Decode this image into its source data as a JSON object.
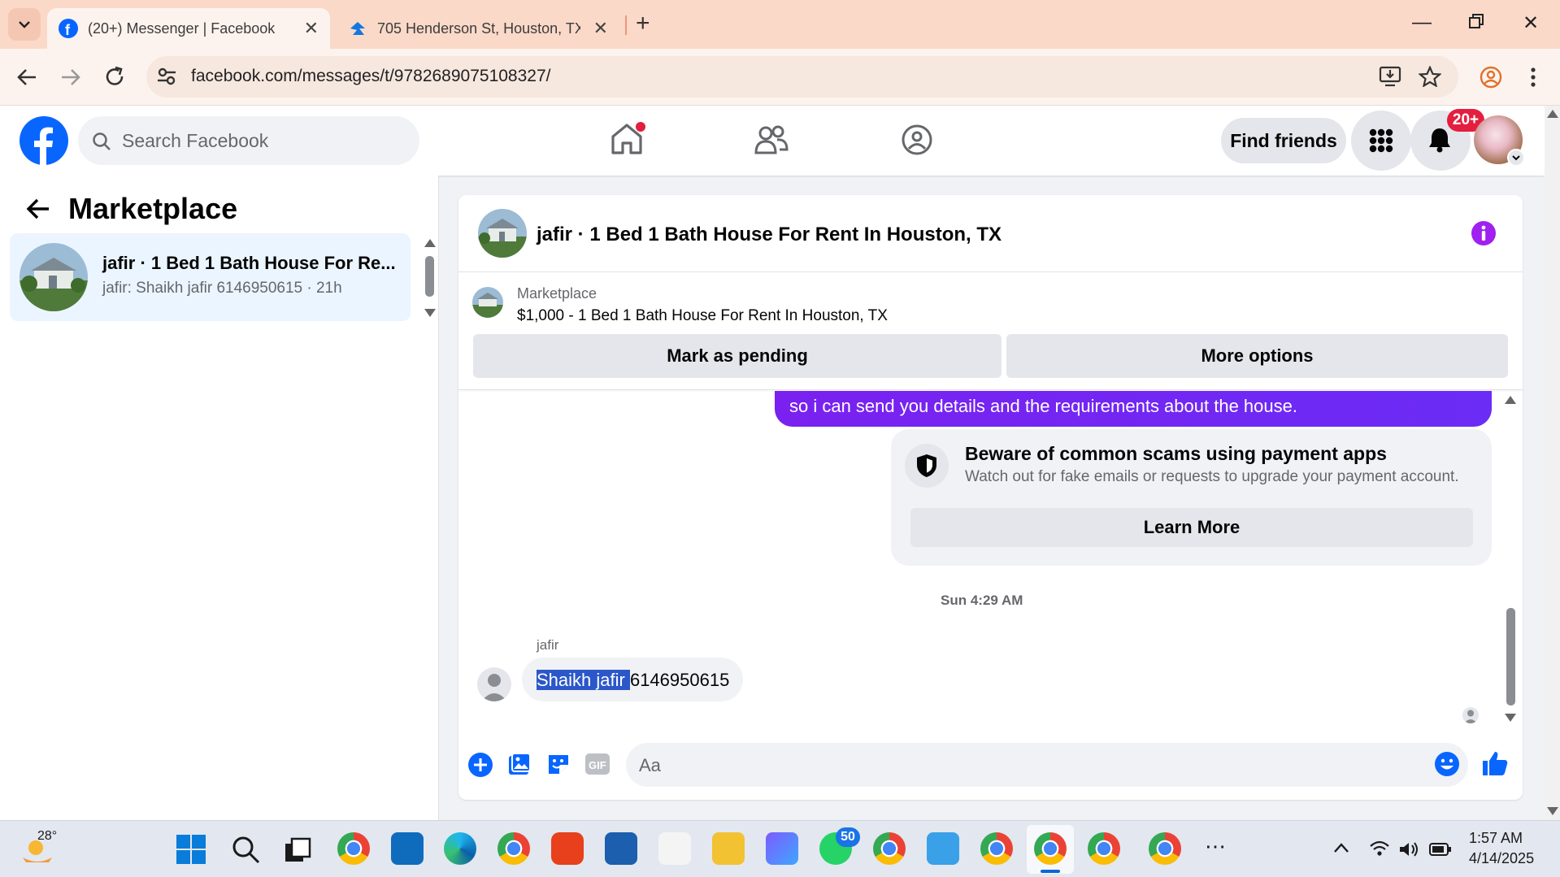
{
  "browser": {
    "tabs": [
      {
        "title": "(20+) Messenger | Facebook",
        "icon": "facebook-icon"
      },
      {
        "title": "705 Henderson St, Houston, TX",
        "icon": "zillow-icon"
      }
    ],
    "url": "facebook.com/messages/t/9782689075108327/"
  },
  "fb_header": {
    "search_placeholder": "Search Facebook",
    "find_friends": "Find friends",
    "notification_badge": "20+"
  },
  "left_panel": {
    "title": "Marketplace",
    "conversations": [
      {
        "name": "jafir · 1 Bed 1 Bath House For Re...",
        "preview": "jafir: Shaikh jafir 6146950615 · 21h"
      }
    ]
  },
  "chat": {
    "title": "jafir · 1 Bed 1 Bath House For Rent In Houston, TX",
    "marketplace_label": "Marketplace",
    "listing": "$1,000 - 1 Bed 1 Bath House For Rent In Houston, TX",
    "mark_pending": "Mark as pending",
    "more_options": "More options",
    "outgoing_message": "so i can send you details and the requirements about the house.",
    "scam_title": "Beware of common scams using payment apps",
    "scam_subtitle": "Watch out for fake emails or requests to upgrade your payment account.",
    "learn_more": "Learn More",
    "timestamp": "Sun 4:29 AM",
    "sender": "jafir",
    "incoming_selected": "Shaikh jafir ",
    "incoming_rest": "6146950615",
    "composer_placeholder": "Aa"
  },
  "taskbar": {
    "weather": "28°",
    "whatsapp_badge": "50",
    "time": "1:57 AM",
    "date": "4/14/2025"
  },
  "colors": {
    "accent_purple": "#7a21f0",
    "fb_blue": "#0866ff",
    "badge_red": "#e41e3f",
    "info_purple": "#a020f0"
  }
}
